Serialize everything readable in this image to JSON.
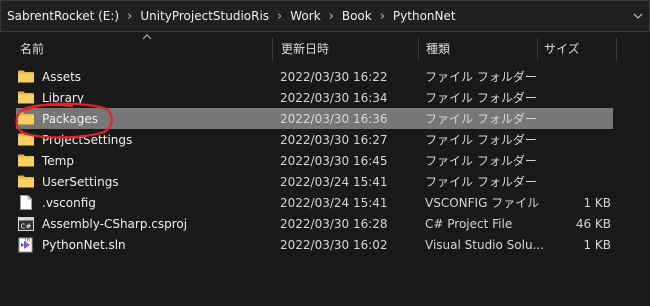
{
  "breadcrumb": [
    {
      "label": "SabrentRocket (E:)"
    },
    {
      "label": "UnityProjectStudioRis"
    },
    {
      "label": "Work"
    },
    {
      "label": "Book"
    },
    {
      "label": "PythonNet"
    }
  ],
  "columns": {
    "name": "名前",
    "date": "更新日時",
    "type": "種類",
    "size": "サイズ"
  },
  "files": [
    {
      "name": "Assets",
      "date": "2022/03/30 16:22",
      "type": "ファイル フォルダー",
      "size": "",
      "icon": "folder-icon"
    },
    {
      "name": "Library",
      "date": "2022/03/30 16:34",
      "type": "ファイル フォルダー",
      "size": "",
      "icon": "folder-icon"
    },
    {
      "name": "Packages",
      "date": "2022/03/30 16:36",
      "type": "ファイル フォルダー",
      "size": "",
      "icon": "folder-icon"
    },
    {
      "name": "ProjectSettings",
      "date": "2022/03/30 16:27",
      "type": "ファイル フォルダー",
      "size": "",
      "icon": "folder-icon"
    },
    {
      "name": "Temp",
      "date": "2022/03/30 16:45",
      "type": "ファイル フォルダー",
      "size": "",
      "icon": "folder-icon"
    },
    {
      "name": "UserSettings",
      "date": "2022/03/24 15:41",
      "type": "ファイル フォルダー",
      "size": "",
      "icon": "folder-icon"
    },
    {
      "name": ".vsconfig",
      "date": "2022/03/24 15:41",
      "type": "VSCONFIG ファイル",
      "size": "1 KB",
      "icon": "file-icon"
    },
    {
      "name": "Assembly-CSharp.csproj",
      "date": "2022/03/30 16:28",
      "type": "C# Project File",
      "size": "46 KB",
      "icon": "csproj-icon"
    },
    {
      "name": "PythonNet.sln",
      "date": "2022/03/30 16:02",
      "type": "Visual Studio Solu...",
      "size": "1 KB",
      "icon": "sln-icon"
    }
  ],
  "selected_index": 2,
  "colors": {
    "selected_row": "#777777",
    "folder": "#f5c84a",
    "highlight": "#e0262a"
  }
}
